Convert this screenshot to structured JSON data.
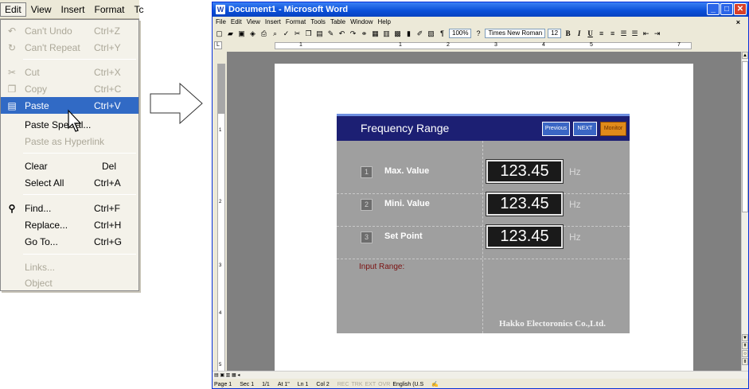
{
  "edit_menu": {
    "menubar": [
      "Edit",
      "View",
      "Insert",
      "Format",
      "Tc"
    ],
    "items": [
      {
        "label": "Can't Undo",
        "shortcut": "Ctrl+Z",
        "icon": "undo-icon",
        "glyph": "↶",
        "disabled": true
      },
      {
        "label": "Can't Repeat",
        "shortcut": "Ctrl+Y",
        "icon": "repeat-icon",
        "glyph": "↻",
        "disabled": true
      },
      {
        "label": "Cut",
        "shortcut": "Ctrl+X",
        "icon": "scissors-icon",
        "glyph": "✂",
        "disabled": true
      },
      {
        "label": "Copy",
        "shortcut": "Ctrl+C",
        "icon": "copy-icon",
        "glyph": "❐",
        "disabled": true
      },
      {
        "label": "Paste",
        "shortcut": "Ctrl+V",
        "icon": "clipboard-icon",
        "glyph": "📋",
        "disabled": false,
        "selected": true
      },
      {
        "label": "Paste Special...",
        "shortcut": "",
        "disabled": false
      },
      {
        "label": "Paste as Hyperlink",
        "shortcut": "",
        "disabled": true
      },
      {
        "label": "Clear",
        "shortcut": "Del",
        "disabled": false
      },
      {
        "label": "Select All",
        "shortcut": "Ctrl+A",
        "disabled": false
      },
      {
        "label": "Find...",
        "shortcut": "Ctrl+F",
        "icon": "binoculars-icon",
        "glyph": "⚲",
        "disabled": false
      },
      {
        "label": "Replace...",
        "shortcut": "Ctrl+H",
        "disabled": false
      },
      {
        "label": "Go To...",
        "shortcut": "Ctrl+G",
        "disabled": false
      },
      {
        "label": "Links...",
        "shortcut": "",
        "disabled": true
      },
      {
        "label": "Object",
        "shortcut": "",
        "disabled": true
      }
    ]
  },
  "word": {
    "title": "Document1 - Microsoft Word",
    "menus": [
      "File",
      "Edit",
      "View",
      "Insert",
      "Format",
      "Tools",
      "Table",
      "Window",
      "Help"
    ],
    "toolbar": {
      "zoom": "100%",
      "font": "Times New Roman",
      "size": "12",
      "bold": "B",
      "italic": "I",
      "underline": "U"
    },
    "ruler_numbers": [
      "1",
      "1",
      "2",
      "3",
      "4",
      "5",
      "7"
    ],
    "vruler_numbers": [
      "1",
      "2",
      "3",
      "4",
      "5"
    ],
    "status": {
      "page": "Page 1",
      "sec": "Sec 1",
      "pages": "1/1",
      "at": "At 1\"",
      "ln": "Ln 1",
      "col": "Col 2",
      "rec": "REC",
      "trk": "TRK",
      "ext": "EXT",
      "ovr": "OVR",
      "lang": "English (U.S"
    }
  },
  "hmi": {
    "title": "Frequency Range",
    "buttons": {
      "prev": "Previous",
      "next": "NEXT",
      "monitor": "Monitor"
    },
    "rows": [
      {
        "num": "1",
        "label": "Max. Value",
        "value": "123.45",
        "unit": "Hz"
      },
      {
        "num": "2",
        "label": "Mini. Value",
        "value": "123.45",
        "unit": "Hz"
      },
      {
        "num": "3",
        "label": "Set Point",
        "value": "123.45",
        "unit": "Hz"
      }
    ],
    "input_range": "Input Range:",
    "company": "Hakko Electoronics Co.,Ltd."
  }
}
